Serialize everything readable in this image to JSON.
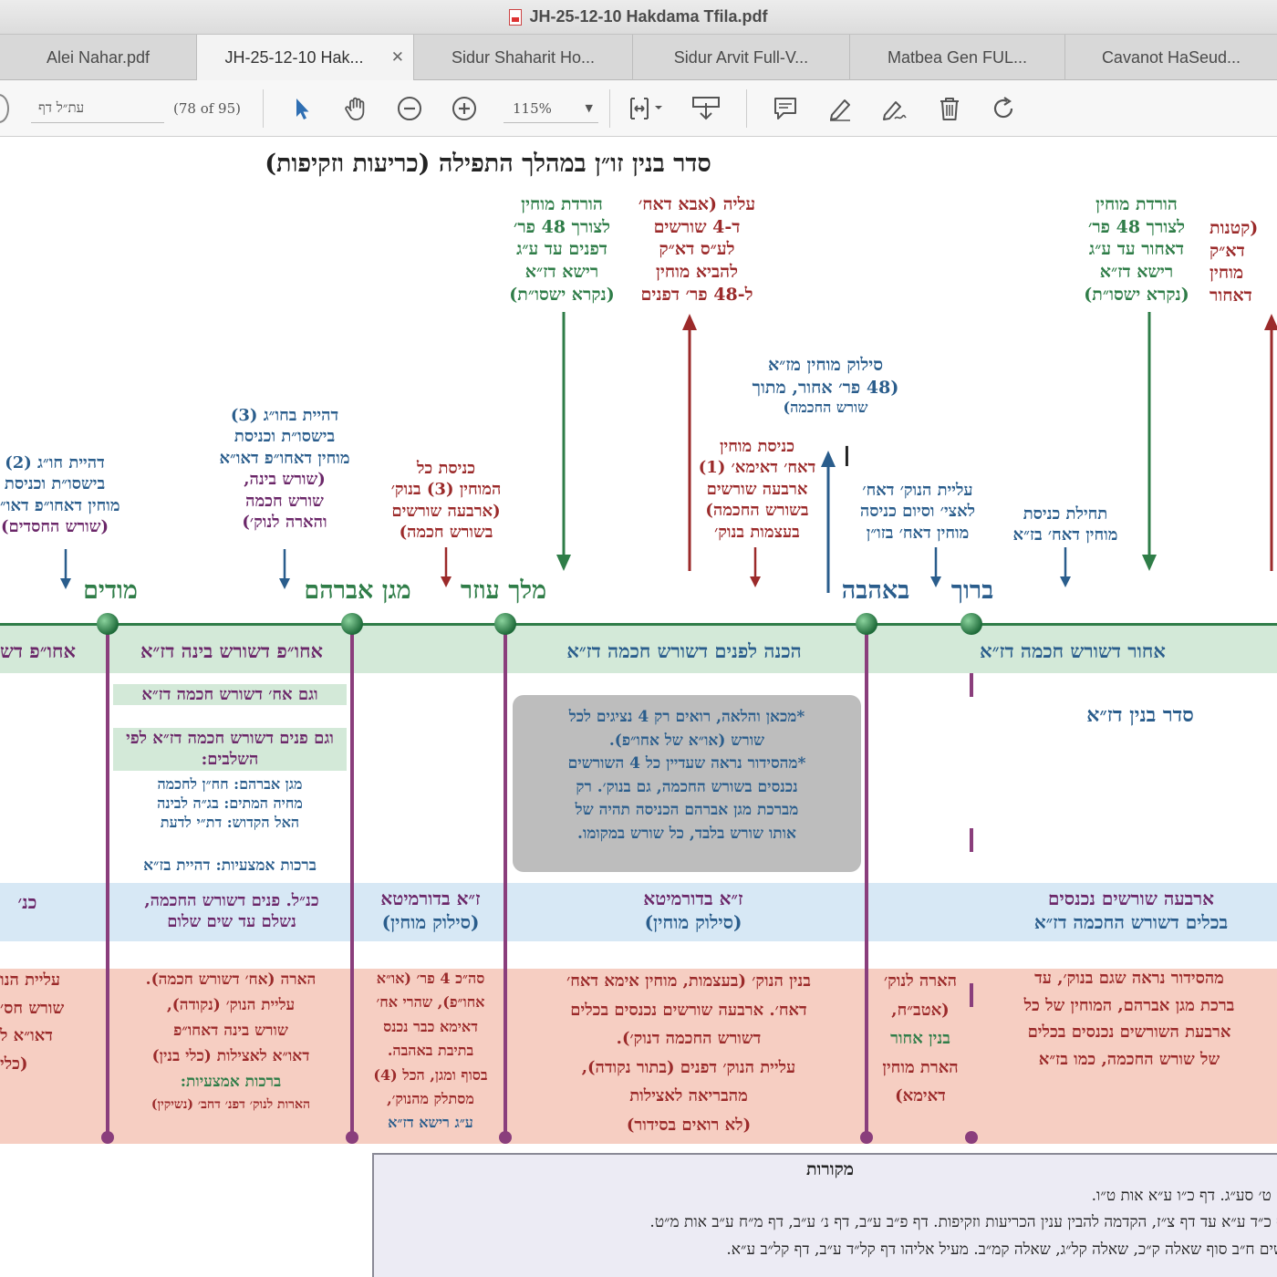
{
  "window": {
    "title": "JH-25-12-10 Hakdama Tfila.pdf"
  },
  "tabs": [
    {
      "label": "Alei Nahar.pdf"
    },
    {
      "label": "JH-25-12-10 Hak...",
      "active": true
    },
    {
      "label": "Sidur Shaharit Ho..."
    },
    {
      "label": "Sidur Arvit Full-V..."
    },
    {
      "label": "Matbea Gen FUL..."
    },
    {
      "label": "Cavanot HaSeud..."
    }
  ],
  "toolbar": {
    "page_field_value": "עת״ל דף",
    "page_count": "(78 of 95)",
    "zoom": "115%",
    "icons": [
      "select-arrow-icon",
      "hand-icon",
      "zoom-out-icon",
      "zoom-in-icon",
      "fit-page-icon",
      "download-icon",
      "comment-icon",
      "highlight-icon",
      "sign-icon",
      "trash-icon",
      "rotate-icon"
    ]
  },
  "doc": {
    "title": "סדר בנין זו״ן במהלך התפילה (כריעות וזקיפות)",
    "top_labels": [
      {
        "lines": [
          "עליה (אבא דאח׳",
          "ד-4 שורשים",
          "לע״ס דא״ק",
          "להביא מוחין",
          "ל-48 פר׳ דפנים"
        ],
        "color": "red"
      },
      {
        "lines": [
          "הורדת מוחין",
          "לצורך 48 פר׳",
          "דפנים עד ע״ג",
          "רישא דז״א",
          "(נקרא ישסו״ת)"
        ],
        "color": "green"
      },
      {
        "lines": [
          "הורדת מוחין",
          "לצורך 48 פר׳",
          "דאחור עד ע״ג",
          "רישא דז״א",
          "(נקרא ישסו״ת)"
        ],
        "color": "green"
      },
      {
        "lines": [
          "(קטנות",
          "דא״ק",
          "מוחין",
          "דאחור"
        ],
        "color": "red"
      }
    ],
    "mid_labels": {
      "siluk": [
        "סילוק מוחין מז״א",
        "(48 פר׳ אחור, מתוך",
        "שורש החכמה)"
      ],
      "knisat_imma": [
        "כניסת מוחין",
        "דאח׳ דאימא׳ (1)",
        "ארבעה שורשים",
        "בשורש החכמה)",
        "בעצמות בנוק׳"
      ],
      "aliyat_nok": [
        "עליית הנוק׳ דאח׳",
        "לאצי׳ וסיום כניסה",
        "מוחין דאח׳ בזו״ן"
      ],
      "tchilat": [
        "תחילת כניסת",
        "מוחין דאח׳ בז״א"
      ],
      "knisat_kol": [
        "כניסת כל",
        "המוחין (3) בנוק׳",
        "(ארבעה שורשים",
        "בשורש חכמה)"
      ],
      "hchg3": [
        "דהיית בחו״ג (3)",
        "בישסו״ת וכניסת",
        "מוחין דאחו״פ דאו״א",
        "(שורש בינה,",
        "שורש חכמה",
        "והארה לנוק׳)"
      ],
      "hchg2": [
        "דהיית חו״ג (2)",
        "בישסו״ת וכניסת",
        "מוחין דאחו״פ דאו״א",
        "(שורש החסדים)"
      ]
    },
    "words": {
      "modim": "מודים",
      "magen": "מגן אברהם",
      "melech": "מלך עוזר",
      "beahava": "באהבה",
      "baruch": "ברוך"
    },
    "green_band": {
      "c1": "אחור דשורש חכמה דז״א",
      "c2": "הכנה לפנים דשורש חכמה דז״א",
      "c3": "אחו״פ דשורש בינה דז״א",
      "c4": "אחו״פ דש"
    },
    "notes": {
      "n1": "וגם אח׳ דשורש חכמה דז״א",
      "n2": "וגם פנים דשורש חכמה דז״א לפי השלבים:",
      "n3": [
        "מגן אברהם: חח״ן לחכמה",
        "מחיה המתים: בג״ה לבינה",
        "האל הקדוש: דת״י לדעת"
      ],
      "n4": "ברכות אמצעיות: דהיית בז״א",
      "sidur": "סדר בנין דז״א",
      "grey_box": [
        "*מכאן והלאה, רואים רק 4 נציגים לכל",
        "שורש (או״א של אחו״פ).",
        "*מהסידור נראה שעדיין כל 4 השורשים",
        "נכנסים בשורש החכמה, גם בנוק׳. רק",
        "מברכת מגן אברהם הכניסה תהיה של",
        "אותו שורש בלבד, כל שורש במקומו."
      ]
    },
    "blue_band": {
      "c1": [
        "ארבעה שורשים נכנסים",
        "בכלים דשורש החכמה דז״א"
      ],
      "c2": [
        "ז״א בדורמיטא",
        "(סילוק מוחין)"
      ],
      "c3": [
        "ז״א בדורמיטא",
        "(סילוק מוחין)"
      ],
      "c4": [
        "כנ״ל. פנים דשורש החכמה,",
        "נשלם עד שים שלום"
      ],
      "c5": "כנ׳"
    },
    "red_band": {
      "c1": [
        "מהסידור נראה שגם בנוק׳, עד",
        "ברכת מגן אברהם, המוחין של כל",
        "ארבעת השורשים נכנסים בכלים",
        "של שורש החכמה, כמו בז״א"
      ],
      "c2": [
        "הארה לנוק׳",
        "(אטב״ח,",
        "בנין אחור",
        "הארת מוחין",
        "דאימא)"
      ],
      "c3": [
        "בנין הנוק׳ (בעצמות, מוחין אימא דאח׳",
        "דאח׳. ארבעה שורשים נכנסים בכלים",
        "דשורש החכמה דנוק׳).",
        "עליית הנוק׳ דפנים (בתור נקודה),",
        "מהבריאה לאצילות",
        "(לא רואים בסידור)"
      ],
      "c4": [
        "סה״כ 4 פר׳ (או״א",
        "אחו״פ), שהרי אח׳",
        "דאימא כבר נכנס",
        "בתיבת באהבה.",
        "בסוף ומגן, הכל (4)",
        "מסתלק מהנוק׳,",
        "ע״ג רישא דז״א"
      ],
      "c5": [
        "הארה (אח׳ דשורש חכמה).",
        "עליית הנוק׳ (נקודה),",
        "שורש בינה דאחו״פ",
        "דאו״א לאצילות (כלי בנין)",
        "ברכות אמצעיות:",
        "הארות לנוק׳ דפנ׳ דחב׳ (נשיקין)"
      ],
      "c6": [
        "עליית הנו",
        "שורש חס׳",
        "דאו״א ל",
        "(כלי"
      ]
    },
    "sources": {
      "header": "מקורות",
      "lines": [
        "ף ט׳ סע״ג. דף כ״ו ע״א אות ט״ו.",
        "ף כ״ד ע״א עד דף צ״ז, הקדמה להבין ענין הכריעות וזקיפות. דף פ״ב ע״ב, דף נ׳ ע״ב, דף מ״ח ע״ב אות מ״ט.",
        "שים ח״ב סוף שאלה ק״כ, שאלה קל״ג, שאלה קמ״ב. מעיל אליהו דף קל״ד ע״ב, דף קל״ב ע״א."
      ]
    }
  }
}
